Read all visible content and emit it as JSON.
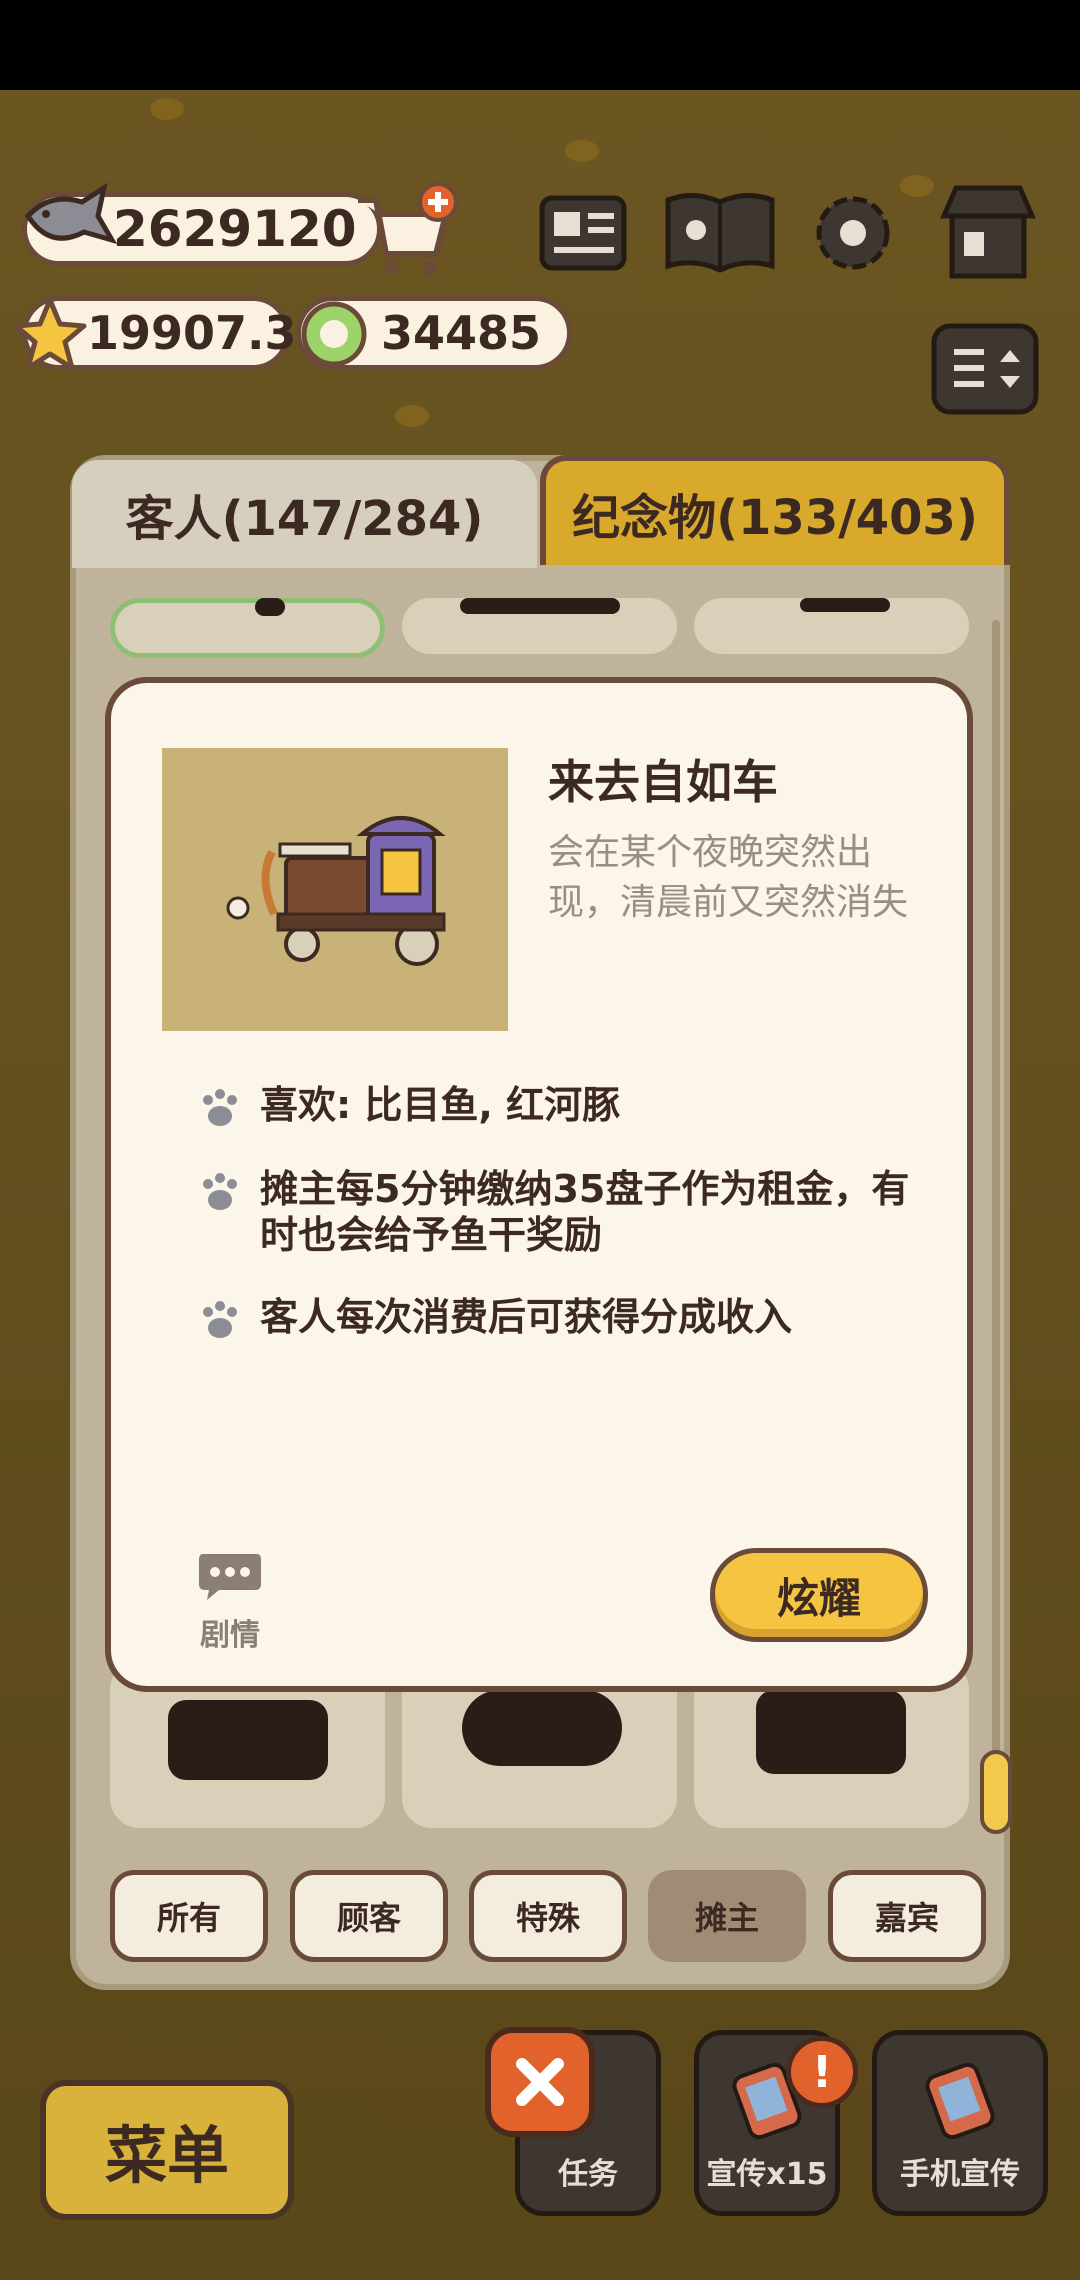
{
  "resources": {
    "fish_amount": "2629120",
    "star_amount": "19907.3",
    "coin_amount": "34485"
  },
  "tabs": [
    {
      "label": "客人(147/284)",
      "active": true
    },
    {
      "label": "纪念物(133/403)",
      "active": false
    }
  ],
  "detail": {
    "name": "来去自如车",
    "description": "会在某个夜晚突然出现，清晨前又突然消失",
    "features": [
      "喜欢: 比目鱼, 红河豚",
      "摊主每5分钟缴纳35盘子作为租金，有时也会给予鱼干奖励",
      "客人每次消费后可获得分成收入"
    ],
    "story_label": "剧情",
    "show_off_label": "炫耀"
  },
  "filters": [
    {
      "label": "所有",
      "active": false
    },
    {
      "label": "顾客",
      "active": false
    },
    {
      "label": "特殊",
      "active": false
    },
    {
      "label": "摊主",
      "active": true
    },
    {
      "label": "嘉宾",
      "active": false
    }
  ],
  "bottom_bar": {
    "menu_label": "菜单",
    "task_label": "任务",
    "promo_label": "宣传x15",
    "phone_promo_label": "手机宣传",
    "badge": "!"
  },
  "colors": {
    "accent": "#f5c542",
    "outline": "#6a4a38",
    "card_bg": "#fbf5ea",
    "alert": "#e1622b"
  }
}
